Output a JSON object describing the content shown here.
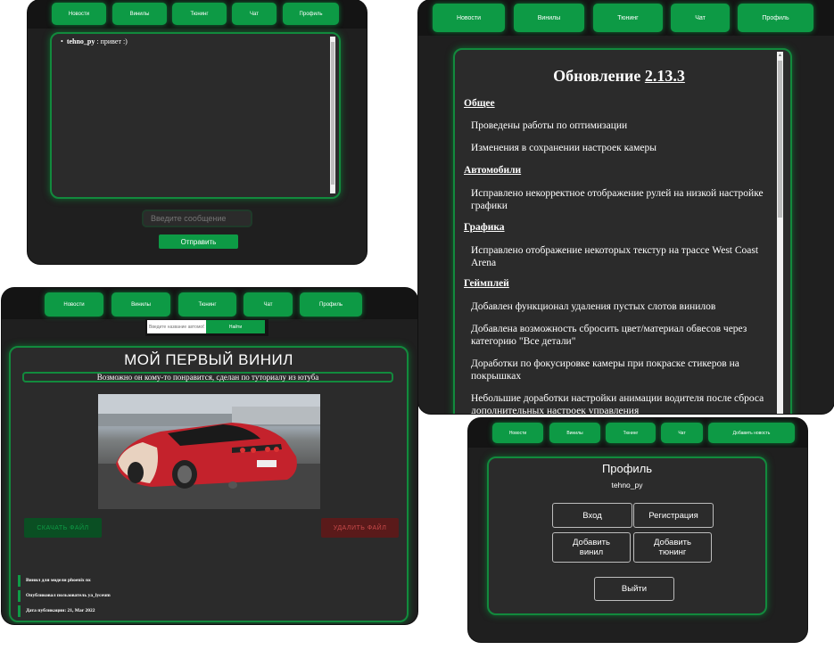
{
  "nav": {
    "news": "Новости",
    "vinyls": "Винилы",
    "tuning": "Тюнинг",
    "chat": "Чат",
    "profile": "Профиль",
    "add_news": "Добавить новость"
  },
  "chat": {
    "message_user": "tehno_py",
    "message_text": " : привет :)",
    "input_placeholder": "Введите сообщение",
    "send": "Отправить"
  },
  "update": {
    "title_prefix": "Обновление ",
    "version": "2.13.3",
    "sections": [
      {
        "heading": "Общее",
        "items": [
          "Проведены работы по оптимизации",
          "Изменения в сохранении настроек камеры"
        ]
      },
      {
        "heading": "Автомобили",
        "items": [
          "Исправлено некорректное отображение рулей на низкой настройке графики"
        ]
      },
      {
        "heading": "Графика",
        "items": [
          "Исправлено отображение некоторых текстур на трассе West Coast Arena"
        ]
      },
      {
        "heading": "Геймплей",
        "items": [
          "Добавлен функционал удаления пустых слотов винилов",
          "Добавлена возможность сбросить цвет/материал обвесов через категорию \"Все детали\"",
          "Доработки по фокусировке камеры при покраске стикеров на покрышках",
          "Небольшие доработки настройки анимации водителя после сброса",
          "дополнительных настроек управления"
        ]
      }
    ]
  },
  "vinyl": {
    "search_placeholder": "Введите название автомобиля",
    "search_button": "Найти",
    "title": "МОЙ ПЕРВЫЙ ВИНИЛ",
    "description": "Возможно он кому-то понравится, сделан по туториалу из ютуба",
    "download": "СКАЧАТЬ ФАЙЛ",
    "delete": "УДАЛИТЬ ФАЙЛ",
    "meta": [
      "Винил для модели phoenix nx",
      "Опубликовал пользователь ya_lyceum",
      "Дата публикации: 21, Mar 2022"
    ]
  },
  "profile": {
    "title": "Профиль",
    "username": "tehno_py",
    "login": "Вход",
    "register": "Регистрация",
    "add_vinyl": "Добавить винил",
    "add_tuning": "Добавить тюнинг",
    "logout": "Выйти"
  },
  "colors": {
    "accent": "#0d9a45",
    "panel": "#2b2b2b",
    "background": "#1f1f1f",
    "download_button": "#0a4f23",
    "delete_button": "#5a1a1a"
  }
}
